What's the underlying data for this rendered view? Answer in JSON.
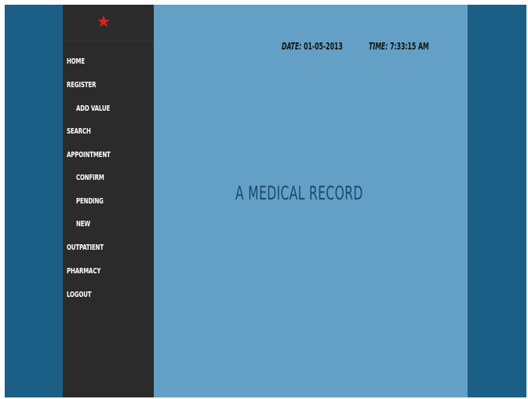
{
  "header": {
    "date_label": "DATE:",
    "date_value": "01-05-2013",
    "time_label": "TIME:",
    "time_value": "7:33:15 AM"
  },
  "sidebar": {
    "logo_icon": "crescent-star-icon",
    "items": [
      {
        "label": "HOME"
      },
      {
        "label": "REGISTER"
      },
      {
        "label": "ADD VALUE"
      },
      {
        "label": "SEARCH"
      },
      {
        "label": "APPOINTMENT"
      },
      {
        "label": "CONFIRM"
      },
      {
        "label": "PENDING"
      },
      {
        "label": "NEW"
      },
      {
        "label": "OUTPATIENT"
      },
      {
        "label": "PHARMACY"
      },
      {
        "label": "LOGOUT"
      }
    ]
  },
  "main": {
    "title": "A MEDICAL RECORD"
  },
  "colors": {
    "frame": "#1b5e86",
    "sidebar": "#2b2b2b",
    "content": "#64a0c5",
    "title": "#184a6e",
    "logo": "#e02020"
  }
}
